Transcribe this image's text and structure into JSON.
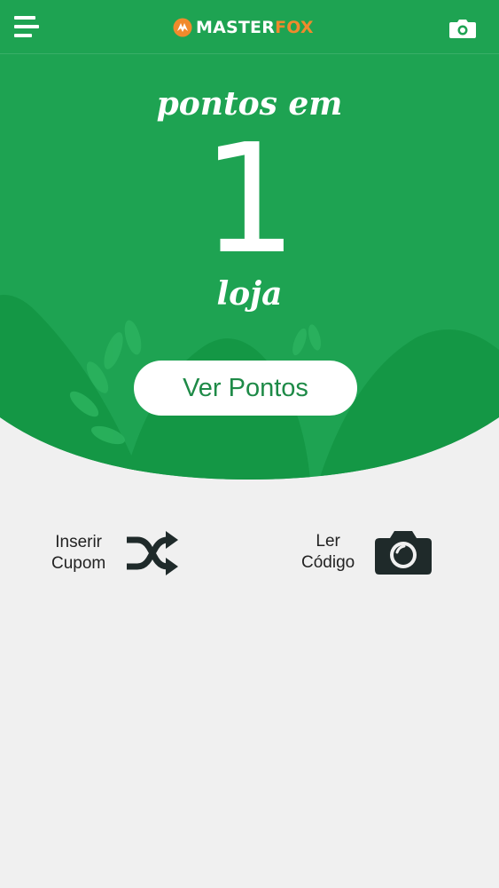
{
  "header": {
    "menu_icon": "hamburger-menu-icon",
    "logo": {
      "part1": "MASTER",
      "part2": "FOX"
    },
    "camera_icon": "camera-icon"
  },
  "hero": {
    "caption_top": "pontos em",
    "count": "1",
    "caption_bottom": "loja",
    "button_label": "Ver Pontos"
  },
  "actions": {
    "coupon": {
      "line1": "Inserir",
      "line2": "Cupom",
      "icon": "shuffle-icon"
    },
    "code": {
      "line1": "Ler",
      "line2": "Código",
      "icon": "camera-icon"
    }
  },
  "colors": {
    "brand_green": "#1ea352",
    "dark_green": "#12893f",
    "accent_orange": "#f08a2c",
    "background": "#f0f0f0",
    "icon_dark": "#1f2a2a"
  }
}
